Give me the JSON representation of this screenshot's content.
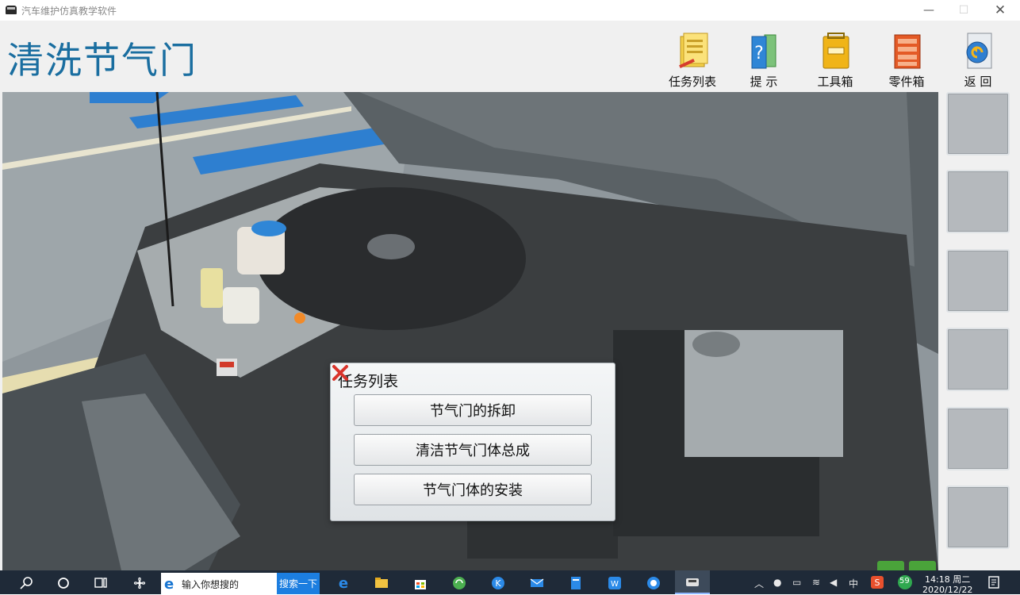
{
  "window": {
    "title": "汽车维护仿真教学软件",
    "minimize": "—",
    "maximize": "☐",
    "close": "✕"
  },
  "header": {
    "page_title": "清洗节气门",
    "tools": [
      {
        "label": "任务列表",
        "icon": "task-list-icon"
      },
      {
        "label": "提  示",
        "icon": "hint-book-icon"
      },
      {
        "label": "工具箱",
        "icon": "toolbox-icon"
      },
      {
        "label": "零件箱",
        "icon": "parts-box-icon"
      },
      {
        "label": "返  回",
        "icon": "back-arrow-icon"
      }
    ]
  },
  "dialog": {
    "title": "任务列表",
    "tasks": [
      "节气门的拆卸",
      "清洁节气门体总成",
      "节气门体的安装"
    ]
  },
  "taskbar": {
    "search_placeholder": "输入你想搜的",
    "search_button": "搜索一下",
    "ime": "中",
    "badge": "59",
    "time": "14:18 周二",
    "date": "2020/12/22"
  },
  "colors": {
    "title_blue": "#1a6ea0",
    "close_red": "#d9342b",
    "nav_green": "#4aa33a",
    "taskbar": "#1f2a38"
  }
}
